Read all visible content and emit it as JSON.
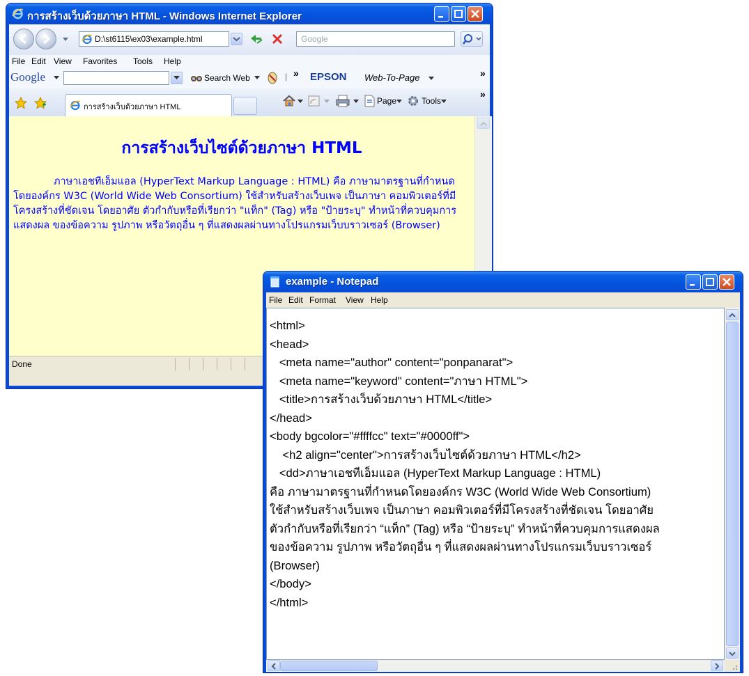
{
  "ie": {
    "title": "การสร้างเว็บด้วยภาษา HTML - Windows Internet Explorer",
    "address": "D:\\st6115\\ex03\\example.html",
    "search_placeholder": "Google",
    "menu": [
      "File",
      "Edit",
      "View",
      "Favorites",
      "Tools",
      "Help"
    ],
    "google_label": "Google",
    "search_web": "Search Web",
    "epson": "EPSON",
    "web_to_page": "Web-To-Page",
    "chevron": "»",
    "tab_title": "การสร้างเว็บด้วยภาษา HTML",
    "page_label": "Page",
    "tools_label": "Tools",
    "status": "Done",
    "page": {
      "heading": "การสร้างเว็บไซต์ด้วยภาษา HTML",
      "paragraph": "ภาษาเอชทีเอ็มแอล (HyperText Markup Language : HTML) คือ ภาษามาตรฐานที่กำหนดโดยองค์กร W3C (World Wide Web Consortium) ใช้สำหรับสร้างเว็บเพจ เป็นภาษา คอมพิวเตอร์ที่มีโครงสร้างที่ชัดเจน โดยอาศัย ตัวกำกับหรือที่เรียกว่า \"แท็ก\" (Tag) หรือ \"ป้ายระบุ\" ทำหน้าที่ควบคุมการแสดงผล ของข้อความ รูปภาพ หรือวัตถุอื่น ๆ ที่แสดงผลผ่านทางโปรแกรมเว็บบราวเซอร์ (Browser)",
      "bgcolor": "#ffffcc",
      "text_color": "#0000ff"
    }
  },
  "notepad": {
    "title": "example - Notepad",
    "menu": [
      "File",
      "Edit",
      "Format",
      "View",
      "Help"
    ],
    "lines": [
      "<html>",
      "<head>",
      "   <meta name=\"author\" content=\"ponpanarat\">",
      "   <meta name=\"keyword\" content=\"ภาษา HTML\">",
      "   <title>การสร้างเว็บด้วยภาษา HTML</title>",
      "</head>",
      "<body bgcolor=\"#ffffcc\" text=\"#0000ff\">",
      "    <h2 align=\"center\">การสร้างเว็บไซต์ด้วยภาษา HTML</h2>",
      "   <dd>ภาษาเอชทีเอ็มแอล (HyperText Markup Language : HTML)",
      "คือ ภาษามาตรฐานที่กำหนดโดยองค์กร W3C (World Wide Web Consortium)",
      "ใช้สำหรับสร้างเว็บเพจ เป็นภาษา คอมพิวเตอร์ที่มีโครงสร้างที่ชัดเจน โดยอาศัย",
      "ตัวกำกับหรือที่เรียกว่า “แท็ก” (Tag) หรือ “ป้ายระบุ” ทำหน้าที่ควบคุมการแสดงผล",
      "ของข้อความ รูปภาพ หรือวัตถุอื่น ๆ ที่แสดงผลผ่านทางโปรแกรมเว็บบราวเซอร์",
      "(Browser)",
      "</body>",
      "</html>"
    ]
  }
}
